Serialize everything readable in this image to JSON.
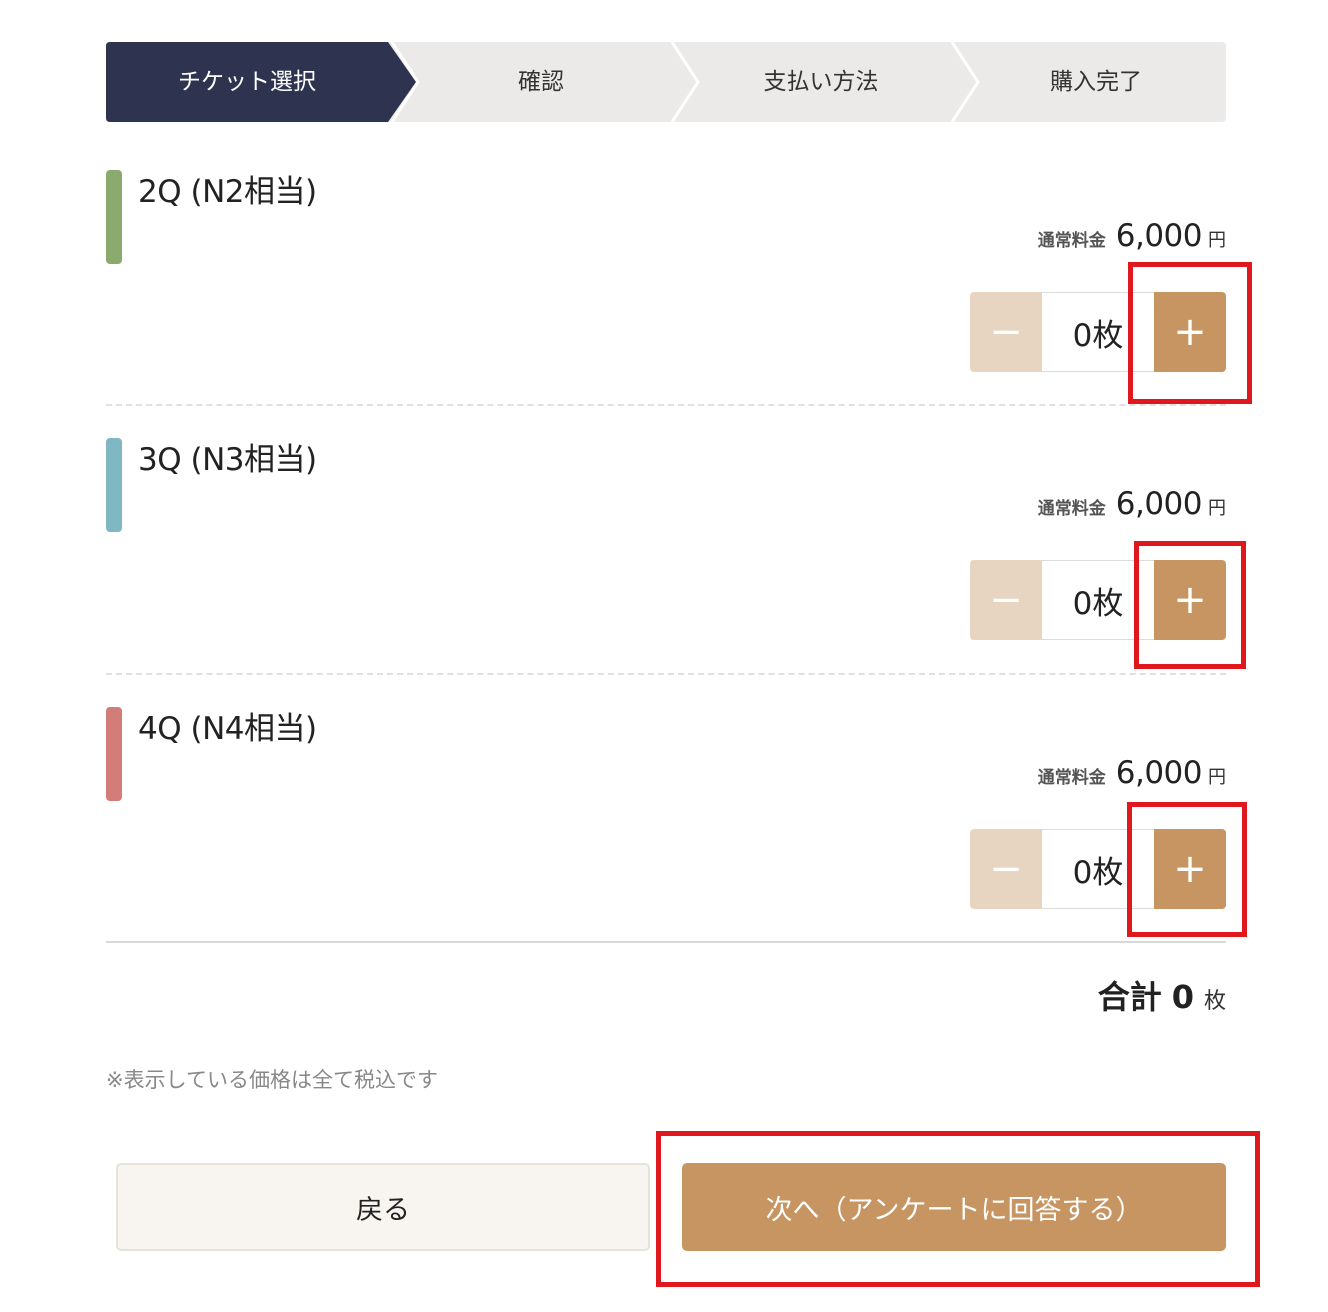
{
  "steps": [
    {
      "label": "チケット選択",
      "active": true
    },
    {
      "label": "確認",
      "active": false
    },
    {
      "label": "支払い方法",
      "active": false
    },
    {
      "label": "購入完了",
      "active": false
    }
  ],
  "colors": {
    "step_active": "#2e3450",
    "step_inactive": "#ebeae8",
    "accent": "#c69561",
    "minus_disabled": "#e7d5c1",
    "highlight": "#e0181d"
  },
  "tickets": [
    {
      "name": "2Q (N2相当)",
      "color": "#8aaa6e",
      "price_label": "通常料金",
      "price": "6,000",
      "price_unit": "円",
      "quantity": "0枚",
      "minus": "−",
      "plus": "+"
    },
    {
      "name": "3Q (N3相当)",
      "color": "#7fb7c2",
      "price_label": "通常料金",
      "price": "6,000",
      "price_unit": "円",
      "quantity": "0枚",
      "minus": "−",
      "plus": "+"
    },
    {
      "name": "4Q (N4相当)",
      "color": "#d27d78",
      "price_label": "通常料金",
      "price": "6,000",
      "price_unit": "円",
      "quantity": "0枚",
      "minus": "−",
      "plus": "+"
    }
  ],
  "total": {
    "label": "合計",
    "value": "0",
    "unit": "枚"
  },
  "note": "※表示している価格は全て税込です",
  "buttons": {
    "back": "戻る",
    "next": "次へ（アンケートに回答する）"
  }
}
